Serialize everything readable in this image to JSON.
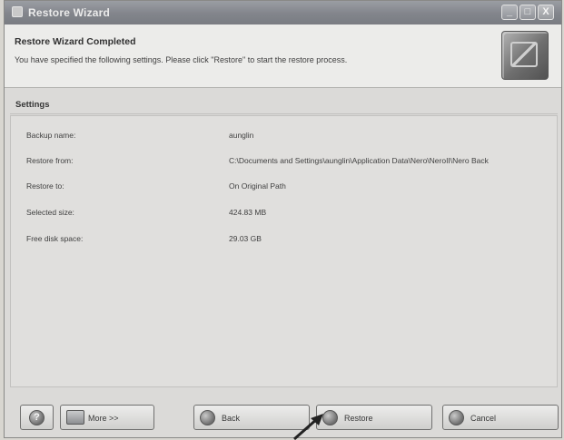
{
  "window": {
    "title": "Restore Wizard",
    "controls": {
      "minimize": "_",
      "maximize": "□",
      "close": "X"
    }
  },
  "header": {
    "title": "Restore Wizard Completed",
    "description": "You have specified the following settings. Please click \"Restore\" to start the restore process."
  },
  "settings": {
    "heading": "Settings",
    "rows": [
      {
        "label": "Backup name:",
        "value": "aunglin"
      },
      {
        "label": "Restore from:",
        "value": "C:\\Documents and Settings\\aunglin\\Application Data\\Nero\\NeroII\\Nero Back"
      },
      {
        "label": "Restore to:",
        "value": "On Original Path"
      },
      {
        "label": "Selected size:",
        "value": "424.83 MB"
      },
      {
        "label": "Free disk space:",
        "value": "29.03 GB"
      }
    ]
  },
  "buttons": {
    "help": "?",
    "more": "More >>",
    "back": "Back",
    "restore": "Restore",
    "cancel": "Cancel"
  }
}
